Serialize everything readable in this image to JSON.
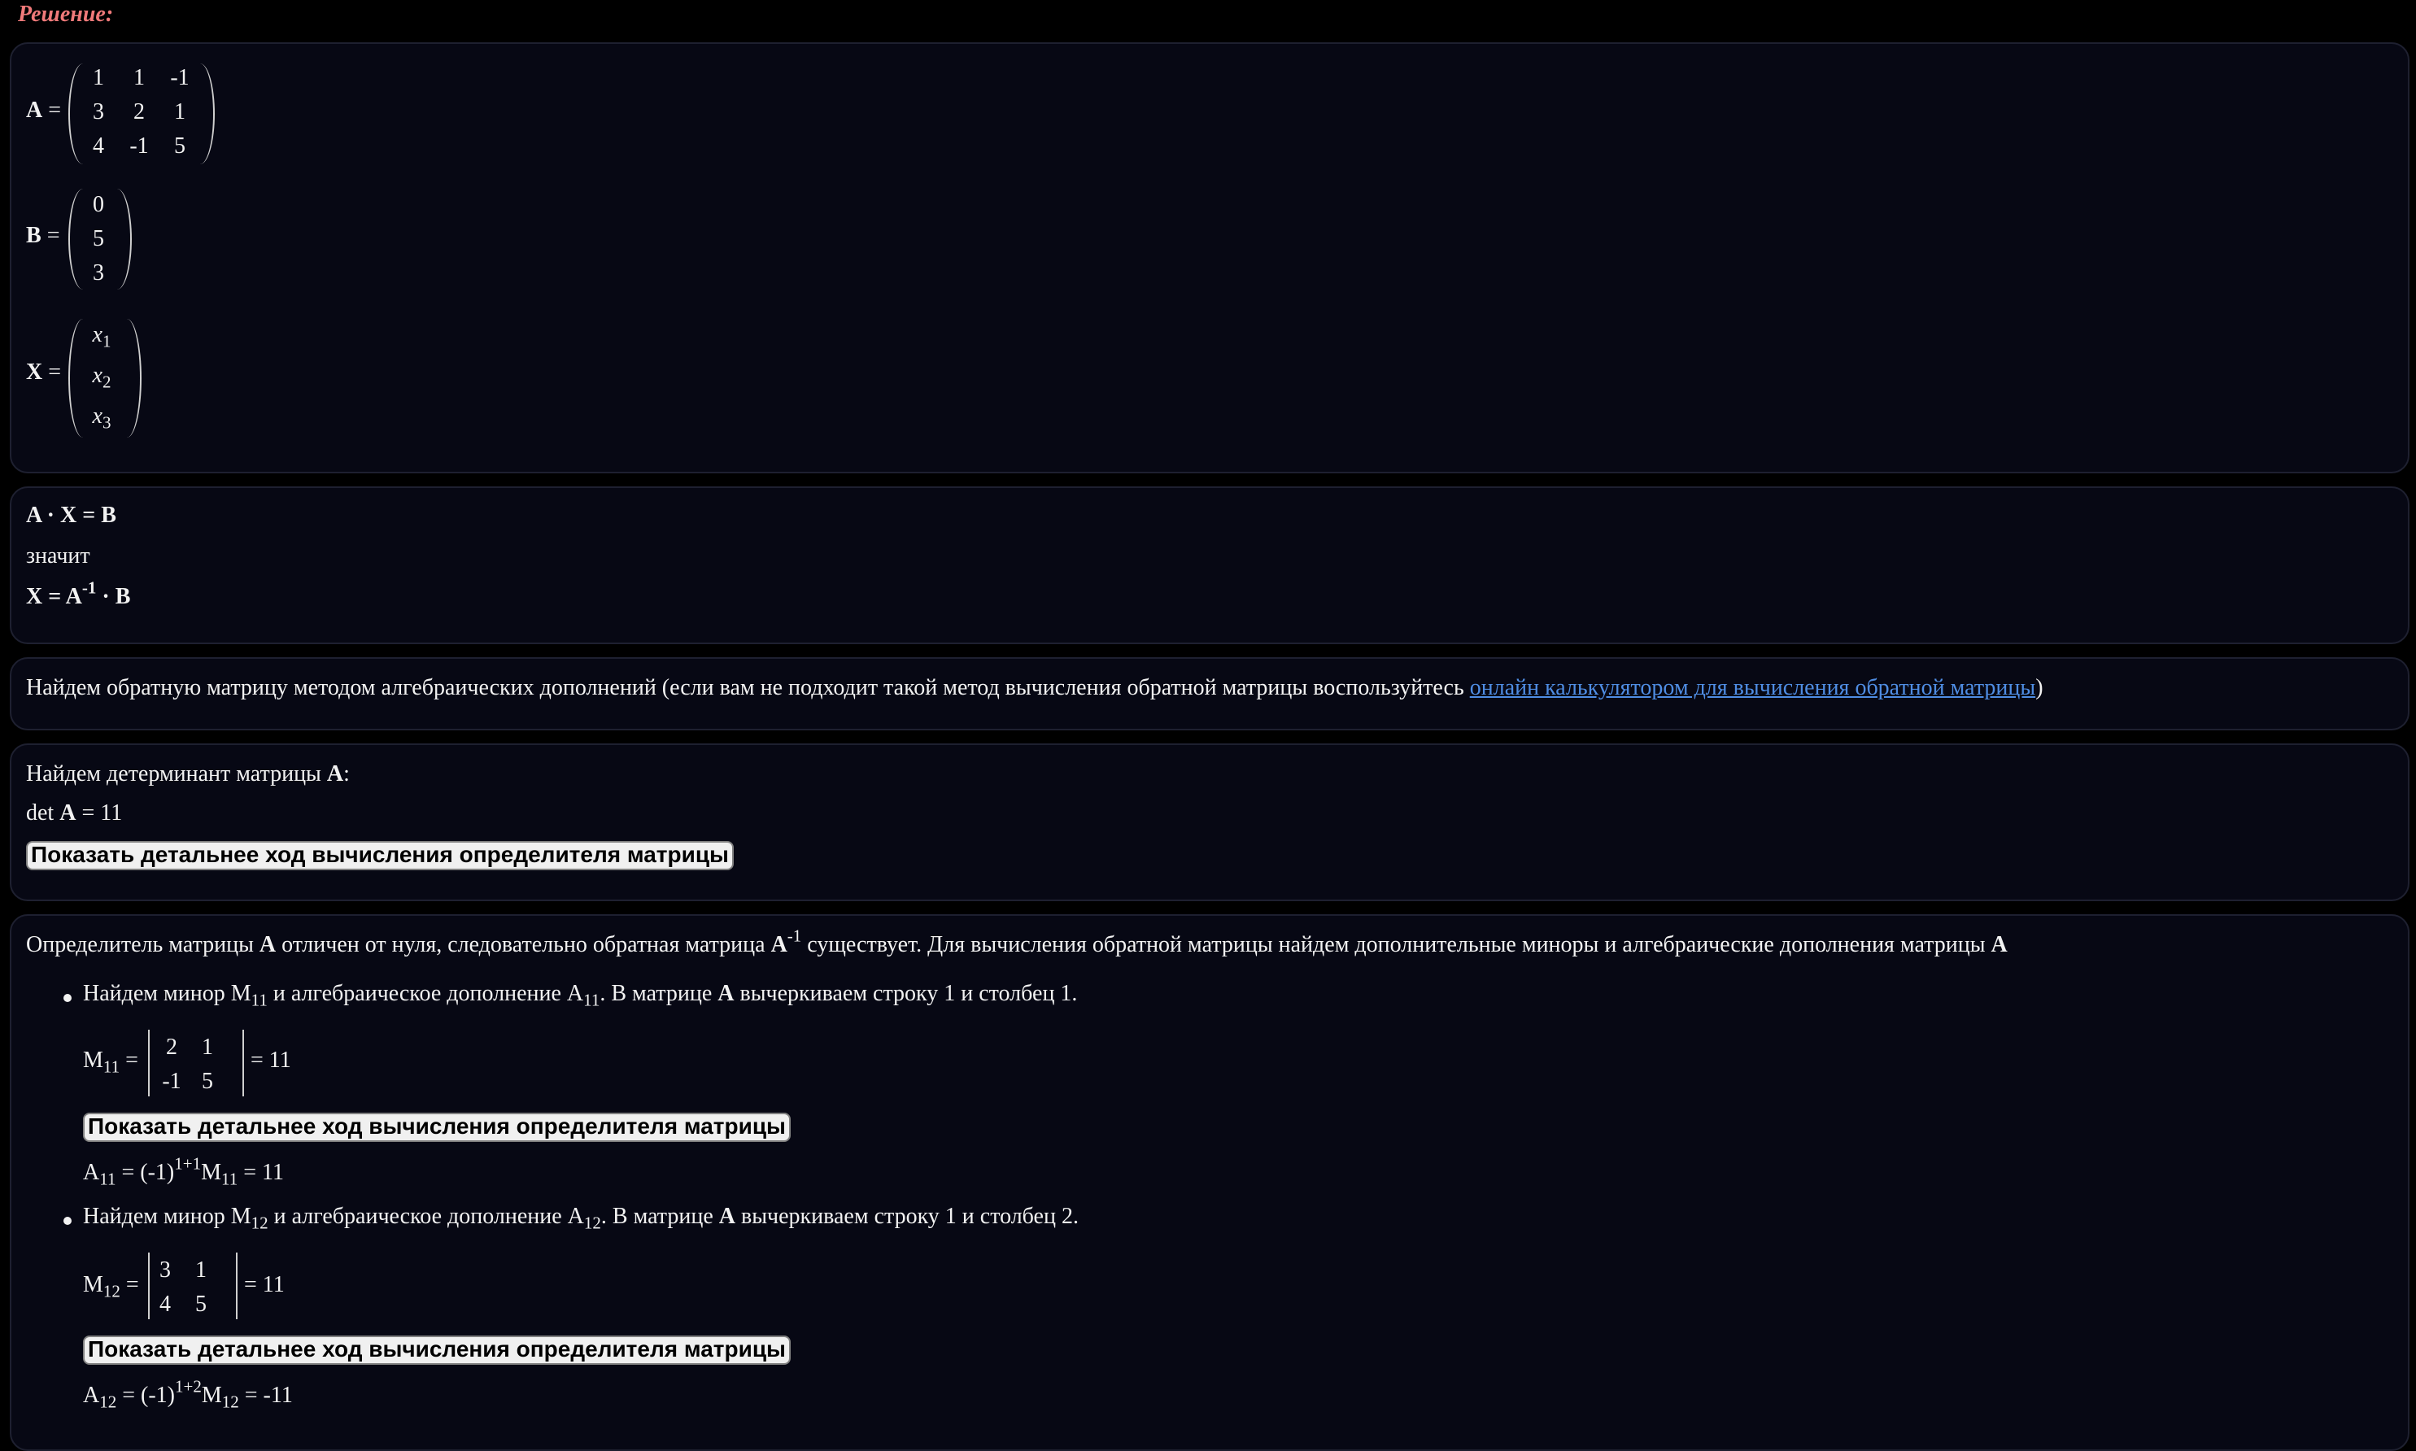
{
  "heading": "Решение:",
  "matrix_a": {
    "label": "A",
    "eq": "=",
    "rows": [
      [
        "1",
        "1",
        "-1"
      ],
      [
        "3",
        "2",
        "1"
      ],
      [
        "4",
        "-1",
        "5"
      ]
    ]
  },
  "matrix_b": {
    "label": "B",
    "eq": "=",
    "rows": [
      [
        "0"
      ],
      [
        "5"
      ],
      [
        "3"
      ]
    ]
  },
  "matrix_x": {
    "label": "X",
    "eq": "=",
    "vars": [
      {
        "v": "x",
        "s": "1"
      },
      {
        "v": "x",
        "s": "2"
      },
      {
        "v": "x",
        "s": "3"
      }
    ]
  },
  "equation": {
    "line1": "A · X = B",
    "line2": "значит",
    "line3_a": "X = A",
    "line3_sup": "-1",
    "line3_b": " · B"
  },
  "inverse_intro": {
    "text": "Найдем обратную матрицу методом алгебраических дополнений (если вам не подходит такой метод вычисления обратной матрицы воспользуйтесь ",
    "link": "онлайн калькулятором для вычисления обратной матрицы",
    "tail": ")"
  },
  "determinant": {
    "line1_a": "Найдем детерминант матрицы ",
    "line1_b": "A",
    "line1_c": ":",
    "line2_a": "det ",
    "line2_b": "A",
    "line2_c": " = 11",
    "button": "Показать детальнее ход вычисления определителя матрицы"
  },
  "cofactors": {
    "intro_a": "Определитель матрицы ",
    "intro_b": "A",
    "intro_c": " отличен от нуля, следовательно обратная матрица ",
    "intro_d": "A",
    "intro_sup": "-1",
    "intro_e": " существует. Для вычисления обратной матрицы найдем дополнительные миноры и алгебраические дополнения матрицы ",
    "intro_f": "A",
    "items": [
      {
        "t1": "Найдем минор M",
        "s1": "11",
        "t2": " и алгебраическое дополнение A",
        "s2": "11",
        "t3": ". В матрице ",
        "t4": "A",
        "t5": " вычеркиваем строку 1 и столбец 1.",
        "minor_label": "M",
        "minor_sub": "11",
        "minor_eq": "=",
        "minor": [
          [
            "2",
            "1"
          ],
          [
            "-1",
            "5"
          ]
        ],
        "minor_result": "= 11",
        "button": "Показать детальнее ход вычисления определителя матрицы",
        "cof_a": "A",
        "cof_sub": "11",
        "cof_b": " = (-1)",
        "cof_sup": "1+1",
        "cof_c": "M",
        "cof_sub2": "11",
        "cof_d": " = 11"
      },
      {
        "t1": "Найдем минор M",
        "s1": "12",
        "t2": " и алгебраическое дополнение A",
        "s2": "12",
        "t3": ". В матрице ",
        "t4": "A",
        "t5": " вычеркиваем строку 1 и столбец 2.",
        "minor_label": "M",
        "minor_sub": "12",
        "minor_eq": "=",
        "minor": [
          [
            "3",
            "1"
          ],
          [
            "4",
            "5"
          ]
        ],
        "minor_result": "= 11",
        "button": "Показать детальнее ход вычисления определителя матрицы",
        "cof_a": "A",
        "cof_sub": "12",
        "cof_b": " = (-1)",
        "cof_sup": "1+2",
        "cof_c": "M",
        "cof_sub2": "12",
        "cof_d": " = -11"
      }
    ]
  }
}
